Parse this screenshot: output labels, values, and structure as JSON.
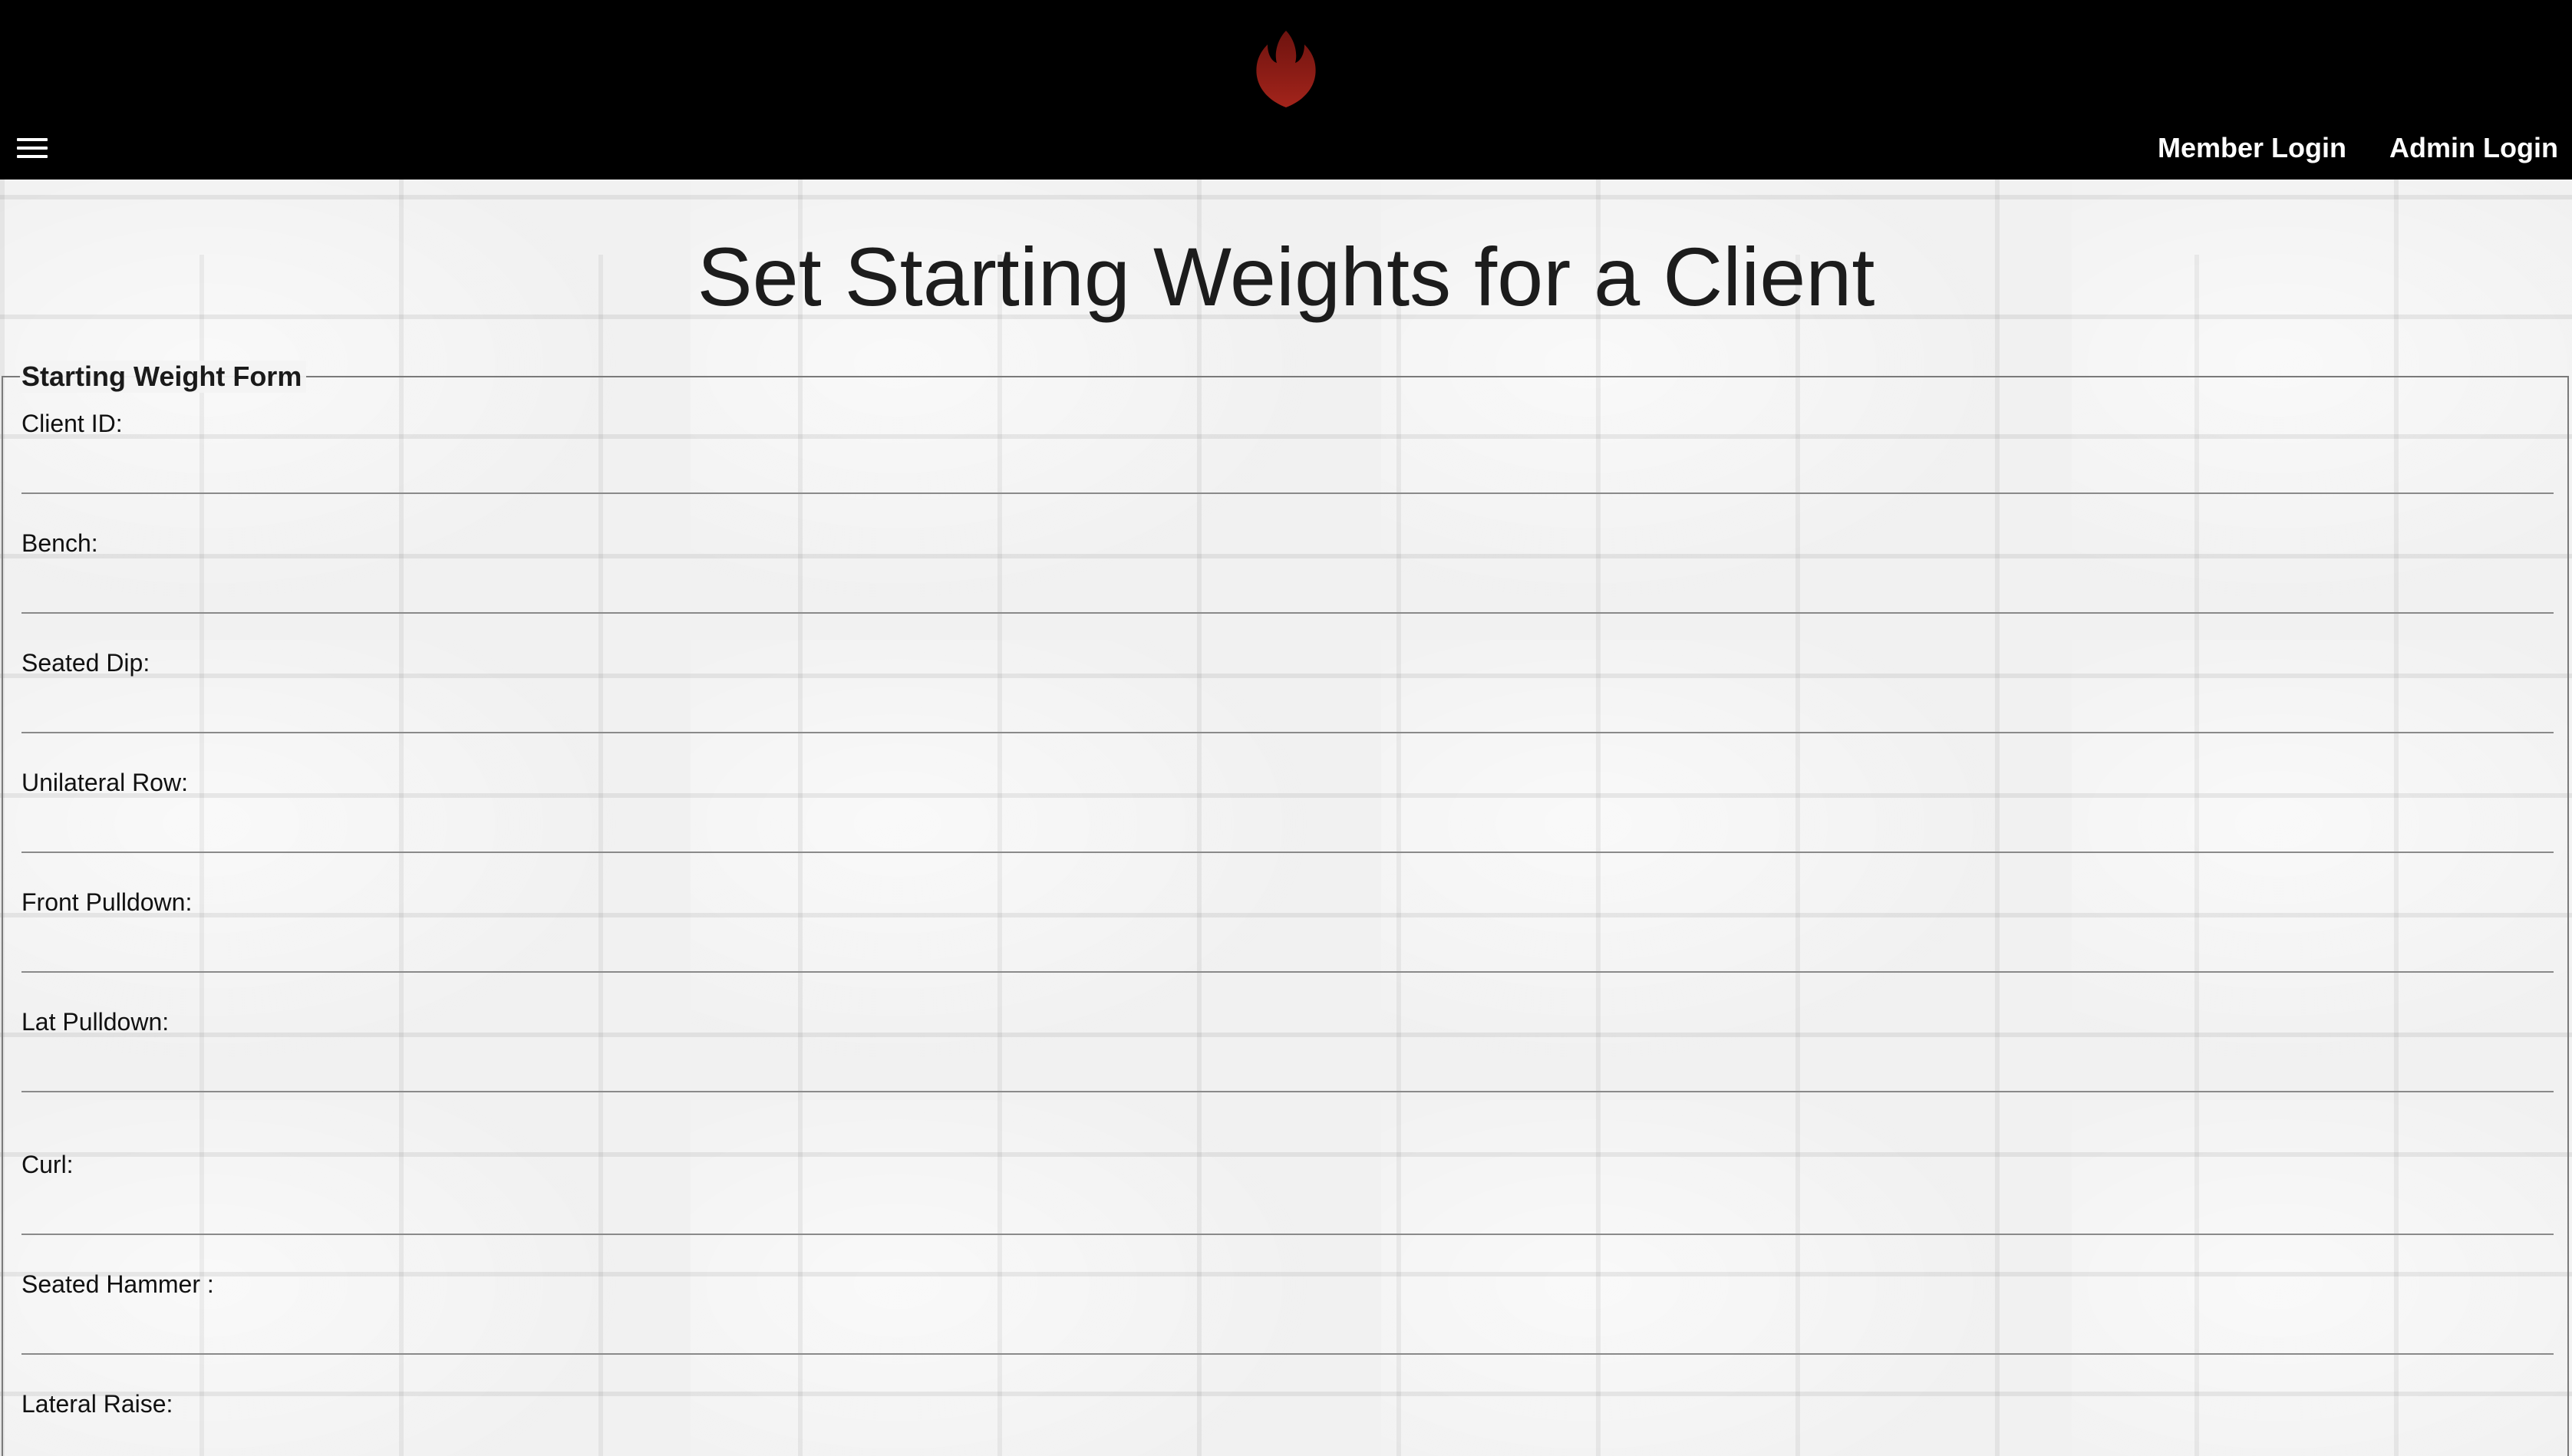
{
  "header": {
    "logo_icon": "flame-logo-icon",
    "menu_icon": "hamburger-menu-icon",
    "nav": {
      "member_login": "Member Login",
      "admin_login": "Admin Login"
    }
  },
  "main": {
    "title": "Set Starting Weights for a Client",
    "form": {
      "legend": "Starting Weight Form",
      "fields": [
        {
          "label": "Client ID:",
          "value": ""
        },
        {
          "label": "Bench:",
          "value": ""
        },
        {
          "label": "Seated Dip:",
          "value": ""
        },
        {
          "label": "Unilateral Row:",
          "value": ""
        },
        {
          "label": "Front Pulldown:",
          "value": ""
        },
        {
          "label": "Lat Pulldown:",
          "value": ""
        },
        {
          "label": "Curl:",
          "value": ""
        },
        {
          "label": "Seated Hammer :",
          "value": ""
        },
        {
          "label": "Lateral Raise:",
          "value": ""
        }
      ]
    }
  },
  "colors": {
    "header_bg": "#000000",
    "logo_red": "#8b1a14",
    "nav_text": "#ffffff",
    "background": "#f1f1f1"
  }
}
